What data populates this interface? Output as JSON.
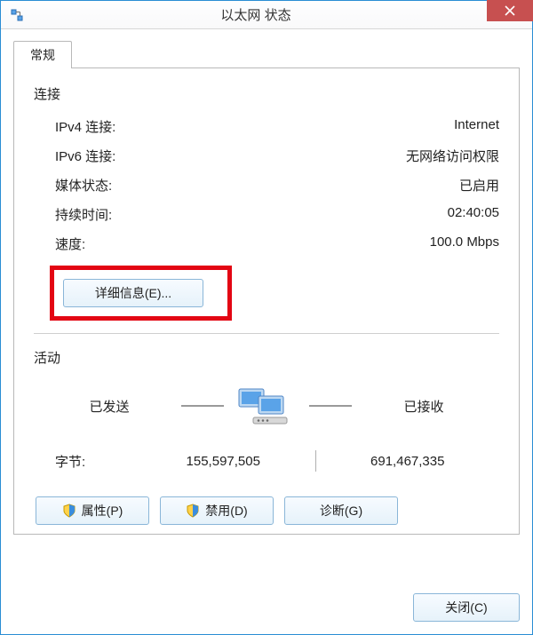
{
  "window": {
    "title": "以太网 状态"
  },
  "tabs": {
    "general": "常规"
  },
  "connection": {
    "section_title": "连接",
    "ipv4_label": "IPv4 连接:",
    "ipv4_value": "Internet",
    "ipv6_label": "IPv6 连接:",
    "ipv6_value": "无网络访问权限",
    "media_label": "媒体状态:",
    "media_value": "已启用",
    "duration_label": "持续时间:",
    "duration_value": "02:40:05",
    "speed_label": "速度:",
    "speed_value": "100.0 Mbps",
    "details_button": "详细信息(E)..."
  },
  "activity": {
    "section_title": "活动",
    "sent_label": "已发送",
    "received_label": "已接收",
    "bytes_label": "字节:",
    "bytes_sent": "155,597,505",
    "bytes_received": "691,467,335"
  },
  "buttons": {
    "properties": "属性(P)",
    "disable": "禁用(D)",
    "diagnose": "诊断(G)",
    "close": "关闭(C)"
  }
}
